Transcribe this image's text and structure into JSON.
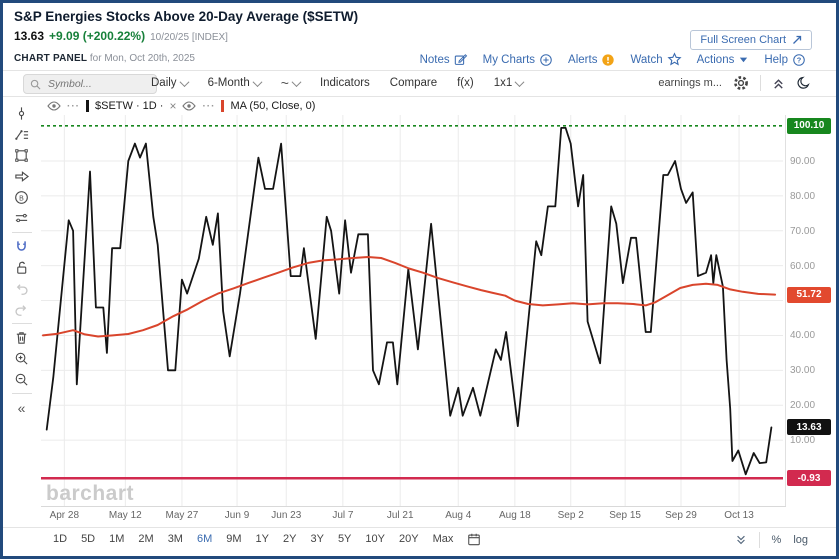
{
  "header": {
    "title": "S&P Energies Stocks Above 20-Day Average ($SETW)",
    "last_price": "13.63",
    "change": "+9.09 (+200.22%)",
    "date_info": "10/20/25 [INDEX]",
    "panel_label": "CHART PANEL",
    "panel_date": "for Mon, Oct 20th, 2025",
    "full_screen_label": "Full Screen Chart",
    "links": [
      {
        "label": "Notes",
        "icon": "notes-icon"
      },
      {
        "label": "My Charts",
        "icon": "plus-circle-icon"
      },
      {
        "label": "Alerts",
        "icon": "alert-icon"
      },
      {
        "label": "Watch",
        "icon": "star-icon"
      },
      {
        "label": "Actions",
        "icon": "caret-down-icon"
      },
      {
        "label": "Help",
        "icon": "help-icon"
      }
    ]
  },
  "toolbar": {
    "symbol_placeholder": "Symbol...",
    "frequency": "Daily",
    "range": "6-Month",
    "line_style": "~",
    "indicators": "Indicators",
    "compare": "Compare",
    "fx": "f(x)",
    "grid_layout": "1x1",
    "earnings": "earnings m..."
  },
  "legend": {
    "series1": "$SETW · 1D ·",
    "close": "×",
    "series2": "MA (50, Close, 0)"
  },
  "watermark": "barchart",
  "bottom": {
    "ranges": [
      "1D",
      "5D",
      "1M",
      "2M",
      "3M",
      "6M",
      "9M",
      "1Y",
      "2Y",
      "3Y",
      "5Y",
      "10Y",
      "20Y",
      "Max"
    ],
    "selected": "6M",
    "percent": "%",
    "log": "log"
  },
  "colors": {
    "price_line": "#141414",
    "ma_line": "#d9452c",
    "high_level": "#17871e",
    "low_level": "#d22a4f",
    "last_badge": "#111111",
    "link_blue": "#3a6bb0"
  },
  "chart_data": {
    "type": "line",
    "title": "S&P Energies Stocks Above 20-Day Average ($SETW)",
    "ylim": [
      -8.9,
      103.2
    ],
    "grid": true,
    "y_ticks": [
      {
        "label": "90.00",
        "value": 90
      },
      {
        "label": "80.00",
        "value": 80
      },
      {
        "label": "70.00",
        "value": 70
      },
      {
        "label": "60.00",
        "value": 60
      },
      {
        "label": "50.00",
        "value": 50
      },
      {
        "label": "40.00",
        "value": 40
      },
      {
        "label": "30.00",
        "value": 30
      },
      {
        "label": "20.00",
        "value": 20
      },
      {
        "label": "10.00",
        "value": 10
      }
    ],
    "x_axis": [
      {
        "label": "Apr 28",
        "f": 0.029
      },
      {
        "label": "May 12",
        "f": 0.112
      },
      {
        "label": "May 27",
        "f": 0.189
      },
      {
        "label": "Jun 9",
        "f": 0.264
      },
      {
        "label": "Jun 23",
        "f": 0.331
      },
      {
        "label": "Jul 7",
        "f": 0.408
      },
      {
        "label": "Jul 21",
        "f": 0.486
      },
      {
        "label": "Aug 4",
        "f": 0.565
      },
      {
        "label": "Aug 18",
        "f": 0.642
      },
      {
        "label": "Sep 2",
        "f": 0.718
      },
      {
        "label": "Sep 15",
        "f": 0.792
      },
      {
        "label": "Sep 29",
        "f": 0.868
      },
      {
        "label": "Oct 13",
        "f": 0.947
      }
    ],
    "levels": [
      {
        "label": "100.10",
        "value": 100.1,
        "color": "#17871e",
        "dash": true
      },
      {
        "label": "-0.93",
        "value": -0.93,
        "color": "#d22a4f",
        "dash": false
      }
    ],
    "badges": [
      {
        "label": "100.10",
        "value": 100.1,
        "bg": "#17871e"
      },
      {
        "label": "51.72",
        "value": 51.72,
        "bg": "#e2492e"
      },
      {
        "label": "13.63",
        "value": 13.63,
        "bg": "#111111"
      },
      {
        "label": "-0.93",
        "value": -0.93,
        "bg": "#d22a4f"
      }
    ],
    "series": [
      {
        "name": "$SETW 1D",
        "color": "#141414",
        "width": 1.8,
        "points": [
          [
            0.005,
            13
          ],
          [
            0.014,
            28
          ],
          [
            0.035,
            73
          ],
          [
            0.041,
            70
          ],
          [
            0.046,
            26
          ],
          [
            0.064,
            87
          ],
          [
            0.072,
            48
          ],
          [
            0.082,
            48
          ],
          [
            0.087,
            35
          ],
          [
            0.094,
            65
          ],
          [
            0.105,
            65
          ],
          [
            0.116,
            90
          ],
          [
            0.125,
            95
          ],
          [
            0.132,
            91
          ],
          [
            0.14,
            95
          ],
          [
            0.15,
            74
          ],
          [
            0.156,
            66
          ],
          [
            0.17,
            30
          ],
          [
            0.18,
            30
          ],
          [
            0.189,
            56
          ],
          [
            0.196,
            52
          ],
          [
            0.212,
            62
          ],
          [
            0.222,
            74
          ],
          [
            0.231,
            66
          ],
          [
            0.238,
            75
          ],
          [
            0.245,
            47
          ],
          [
            0.254,
            34
          ],
          [
            0.268,
            52
          ],
          [
            0.293,
            91
          ],
          [
            0.302,
            82
          ],
          [
            0.313,
            82
          ],
          [
            0.324,
            95
          ],
          [
            0.337,
            57
          ],
          [
            0.35,
            57
          ],
          [
            0.355,
            65
          ],
          [
            0.371,
            39
          ],
          [
            0.386,
            74
          ],
          [
            0.392,
            70
          ],
          [
            0.403,
            52
          ],
          [
            0.411,
            73
          ],
          [
            0.419,
            58
          ],
          [
            0.429,
            69
          ],
          [
            0.442,
            69
          ],
          [
            0.449,
            30
          ],
          [
            0.457,
            26
          ],
          [
            0.468,
            38
          ],
          [
            0.476,
            38
          ],
          [
            0.482,
            26
          ],
          [
            0.497,
            59
          ],
          [
            0.51,
            36
          ],
          [
            0.528,
            72
          ],
          [
            0.554,
            17
          ],
          [
            0.565,
            25
          ],
          [
            0.571,
            17
          ],
          [
            0.585,
            25
          ],
          [
            0.595,
            17
          ],
          [
            0.616,
            36
          ],
          [
            0.623,
            33
          ],
          [
            0.63,
            41
          ],
          [
            0.646,
            14
          ],
          [
            0.671,
            67
          ],
          [
            0.678,
            63
          ],
          [
            0.687,
            77
          ],
          [
            0.697,
            77
          ],
          [
            0.705,
            99.5
          ],
          [
            0.711,
            99.5
          ],
          [
            0.718,
            95
          ],
          [
            0.728,
            77
          ],
          [
            0.735,
            86
          ],
          [
            0.741,
            44
          ],
          [
            0.758,
            32
          ],
          [
            0.773,
            77
          ],
          [
            0.78,
            72
          ],
          [
            0.789,
            55
          ],
          [
            0.8,
            68
          ],
          [
            0.807,
            68
          ],
          [
            0.82,
            41
          ],
          [
            0.827,
            41
          ],
          [
            0.844,
            86
          ],
          [
            0.85,
            86
          ],
          [
            0.86,
            90
          ],
          [
            0.868,
            82
          ],
          [
            0.875,
            78
          ],
          [
            0.884,
            81
          ],
          [
            0.891,
            57
          ],
          [
            0.902,
            58
          ],
          [
            0.909,
            63
          ],
          [
            0.912,
            55
          ],
          [
            0.916,
            63
          ],
          [
            0.925,
            54
          ],
          [
            0.93,
            33
          ],
          [
            0.935,
            19
          ],
          [
            0.938,
            4
          ],
          [
            0.946,
            7
          ],
          [
            0.956,
            0.2
          ],
          [
            0.967,
            6.3
          ],
          [
            0.975,
            3.4
          ],
          [
            0.984,
            3.6
          ],
          [
            0.991,
            13.63
          ]
        ]
      },
      {
        "name": "MA (50, Close, 0)",
        "color": "#d9452c",
        "width": 2,
        "points": [
          [
            0.0,
            40
          ],
          [
            0.02,
            40.5
          ],
          [
            0.041,
            41.5
          ],
          [
            0.057,
            40.3
          ],
          [
            0.075,
            39.7
          ],
          [
            0.095,
            40
          ],
          [
            0.116,
            40.4
          ],
          [
            0.136,
            41.5
          ],
          [
            0.156,
            43
          ],
          [
            0.177,
            45.5
          ],
          [
            0.197,
            47.5
          ],
          [
            0.218,
            50
          ],
          [
            0.238,
            52
          ],
          [
            0.259,
            53.5
          ],
          [
            0.279,
            55
          ],
          [
            0.299,
            56.5
          ],
          [
            0.32,
            58
          ],
          [
            0.34,
            59.5
          ],
          [
            0.361,
            60.8
          ],
          [
            0.381,
            61.5
          ],
          [
            0.401,
            61.8
          ],
          [
            0.422,
            62.2
          ],
          [
            0.442,
            62.5
          ],
          [
            0.46,
            62.2
          ],
          [
            0.479,
            60.8
          ],
          [
            0.498,
            59.2
          ],
          [
            0.517,
            58
          ],
          [
            0.537,
            56.5
          ],
          [
            0.558,
            55.2
          ],
          [
            0.578,
            54
          ],
          [
            0.596,
            53
          ],
          [
            0.612,
            52.2
          ],
          [
            0.629,
            51.4
          ],
          [
            0.642,
            50
          ],
          [
            0.66,
            49
          ],
          [
            0.68,
            48.6
          ],
          [
            0.701,
            48.9
          ],
          [
            0.721,
            49.2
          ],
          [
            0.741,
            48.9
          ],
          [
            0.762,
            49.2
          ],
          [
            0.782,
            49.2
          ],
          [
            0.803,
            49
          ],
          [
            0.82,
            48.6
          ],
          [
            0.833,
            49.5
          ],
          [
            0.848,
            51.3
          ],
          [
            0.867,
            53.6
          ],
          [
            0.884,
            54.5
          ],
          [
            0.902,
            54.8
          ],
          [
            0.918,
            54.5
          ],
          [
            0.935,
            53.2
          ],
          [
            0.952,
            52.5
          ],
          [
            0.973,
            51.9
          ],
          [
            0.996,
            51.72
          ]
        ]
      }
    ]
  },
  "sidebar_tools": [
    "cursor-tool",
    "annotation-tool",
    "shapes-tool",
    "arrow-tool",
    "circled-b-tool",
    "indicator-lines-tool",
    "magnet-tool",
    "lock-tool",
    "undo",
    "redo",
    "delete-tool",
    "zoom-in",
    "zoom-out",
    "collapse-toolbar"
  ]
}
